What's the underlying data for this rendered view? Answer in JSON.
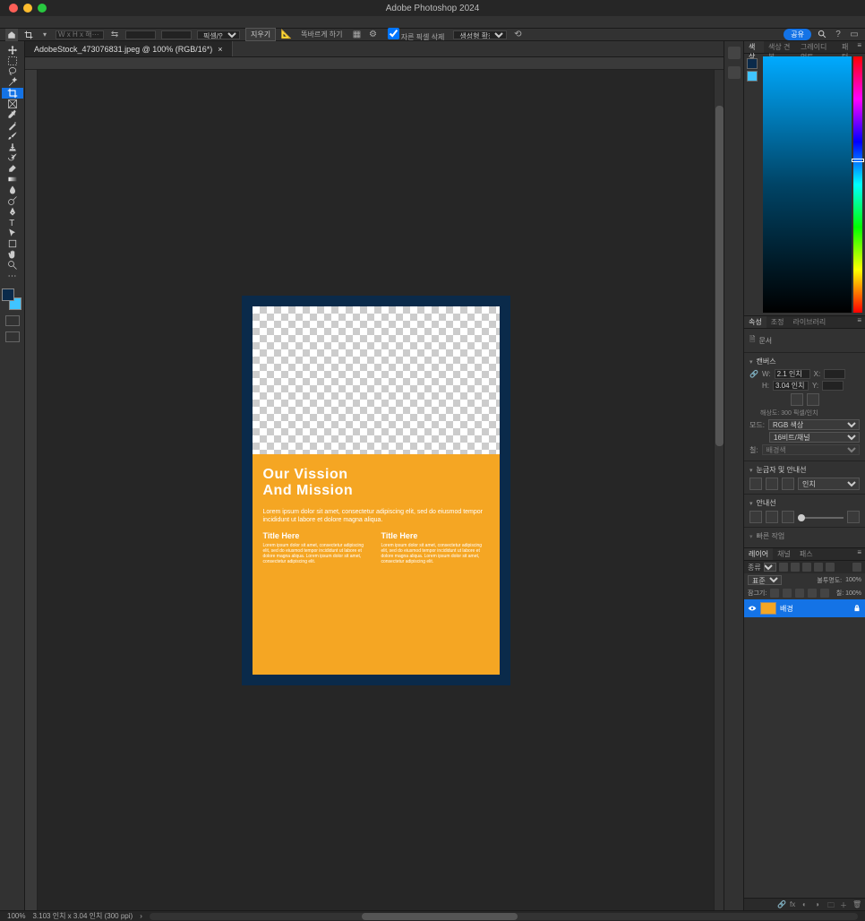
{
  "app_title": "Adobe Photoshop 2024",
  "document": {
    "tab_title": "AdobeStock_473076831.jpeg @ 100% (RGB/16*)",
    "zoom": "100%",
    "status_info": "3.103 인치 x 3.04 인치 (300 ppi)"
  },
  "options_bar": {
    "preset_placeholder": "W x H x 해···",
    "unit": "픽셀/인치",
    "clear": "지우기",
    "straighten": "똑바르게 하기",
    "content_aware": "자른 픽셀 삭제",
    "generative_expand": "생성형 확장",
    "share": "공유"
  },
  "artboard": {
    "heading_line1": "Our Vission",
    "heading_line2": "And Mission",
    "body": "Lorem ipsum dolor sit amet, consectetur adipiscing elit, sed do eiusmod tempor incididunt ut labore et dolore magna aliqua.",
    "col1_title": "Title Here",
    "col1_body": "Lorem ipsum dolor sit amet, consectetur adipiscing elit, sed do eiusmod tempor incididunt ut labore et dolore magna aliqua. Lorem ipsum dolor sit amet, consectetur adipiscing elit.",
    "col2_title": "Title Here",
    "col2_body": "Lorem ipsum dolor sit amet, consectetur adipiscing elit, sed do eiusmod tempor incididunt ut labore et dolore magna aliqua. Lorem ipsum dolor sit amet, consectetur adipiscing elit."
  },
  "color_panel": {
    "tabs": [
      "색상",
      "색상 견본",
      "그레이디언트",
      "패턴"
    ]
  },
  "properties_panel": {
    "tabs": [
      "속성",
      "조정",
      "라이브러리"
    ],
    "doc_label": "문서",
    "canvas_section": "캔버스",
    "width_label": "W:",
    "width_value": "2.1 인치",
    "x_label": "X:",
    "height_label": "H:",
    "height_value": "3.04 인치",
    "y_label": "Y:",
    "resolution": "해상도: 300 픽셀/인치",
    "mode_label": "모드:",
    "mode_value": "RGB 색상",
    "depth_value": "16비트/채널",
    "fill_label": "칠:",
    "fill_value": "배경색",
    "rulers_section": "눈금자 및 안내선",
    "guides_section": "안내선",
    "quick_actions": "빠른 작업"
  },
  "layers_panel": {
    "tabs": [
      "레이어",
      "채널",
      "패스"
    ],
    "kind_label": "종류",
    "blend_mode": "표준",
    "opacity_label": "불투명도:",
    "opacity_value": "100%",
    "lock_label": "잠그기:",
    "layer_name": "배경"
  }
}
